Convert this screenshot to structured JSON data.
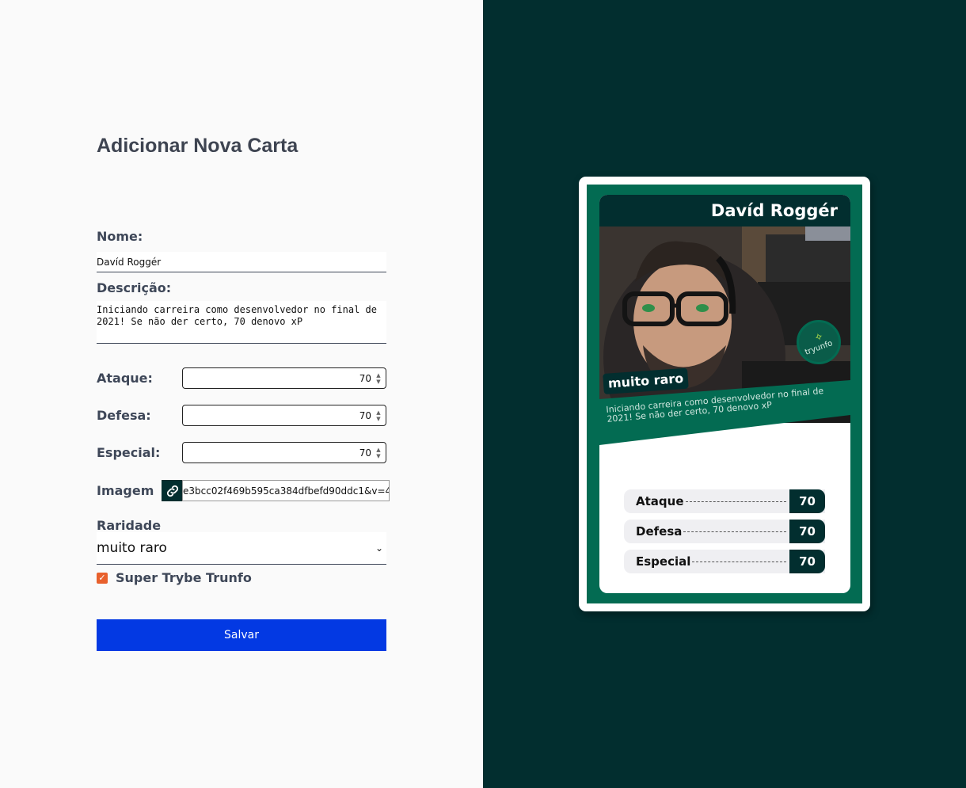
{
  "form": {
    "title": "Adicionar Nova Carta",
    "name_label": "Nome:",
    "name_value": "Davíd Roggér",
    "description_label": "Descrição:",
    "description_value": "Iniciando carreira como desenvolvedor no final de 2021! Se não der certo, 70 denovo xP",
    "attack_label": "Ataque:",
    "attack_value": "70",
    "defense_label": "Defesa:",
    "defense_value": "70",
    "special_label": "Especial:",
    "special_value": "70",
    "image_label": "Imagem",
    "image_value": "e3bcc02f469b595ca384dfbefd90ddc1&v=4",
    "rarity_label": "Raridade",
    "rarity_value": "muito raro",
    "trunfo_label": "Super Trybe Trunfo",
    "trunfo_checked": true,
    "save_label": "Salvar"
  },
  "card": {
    "name": "Davíd Roggér",
    "rarity": "muito raro",
    "description": "Iniciando carreira como desenvolvedor no final de 2021! Se não der certo, 70 denovo xP",
    "badge_text": "tryunfo",
    "attributes": [
      {
        "name": "Ataque",
        "value": "70"
      },
      {
        "name": "Defesa",
        "value": "70"
      },
      {
        "name": "Especial",
        "value": "70"
      }
    ]
  },
  "colors": {
    "dark_green": "#022e2f",
    "card_green": "#036b52",
    "button_blue": "#0339e3",
    "checkbox_orange": "#e8602c"
  }
}
